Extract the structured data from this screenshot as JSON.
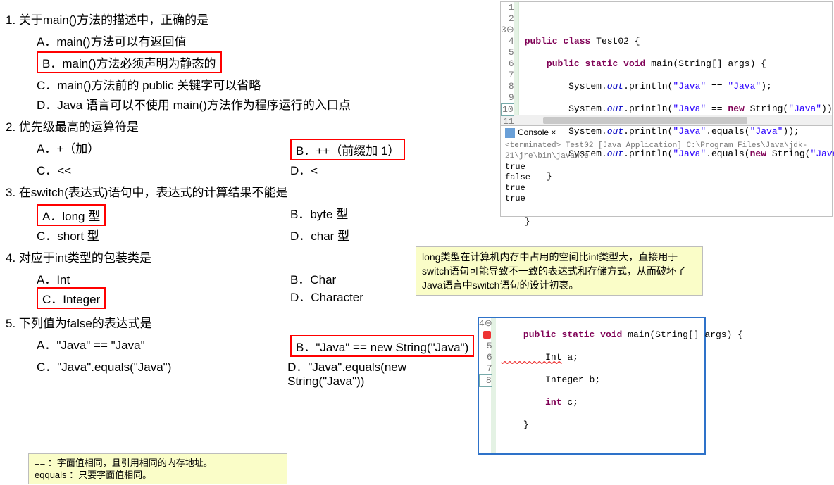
{
  "q1": {
    "title": "1.   关于main()方法的描述中，正确的是",
    "a": "A．main()方法可以有返回值",
    "b": "B．main()方法必须声明为静态的",
    "c": "C．main()方法前的 public 关键字可以省略",
    "d": "D．Java 语言可以不使用 main()方法作为程序运行的入口点"
  },
  "q2": {
    "title": "2.   优先级最高的运算符是",
    "a": "A．+（加）",
    "b": "B．++（前缀加 1）",
    "c": "C．<<",
    "d": "D．<"
  },
  "q3": {
    "title": "3.   在switch(表达式)语句中，表达式的计算结果不能是",
    "a": "A．long 型",
    "b": "B．byte 型",
    "c": "C．short 型",
    "d": "D．char 型"
  },
  "q4": {
    "title": "4.   对应于int类型的包装类是",
    "a": "A．Int",
    "b": "B．Char",
    "c": "C．Integer",
    "d": "D．Character"
  },
  "q5": {
    "title": "5.   下列值为false的表达式是",
    "a": "A．\"Java\" == \"Java\"",
    "b": "B．\"Java\" == new String(\"Java\")",
    "c": "C．\"Java\".equals(\"Java\")",
    "d": "D．\"Java\".equals(new String(\"Java\"))"
  },
  "editor": {
    "lines": [
      "1",
      "2",
      "3",
      "4",
      "5",
      "6",
      "7",
      "8",
      "9",
      "10",
      "11"
    ],
    "c2a": "public class ",
    "c2b": "Test02 {",
    "c3a": "    public static void ",
    "c3b": "main(String[] args) {",
    "c4a": "        System.",
    "c4b": "out",
    "c4c": ".println(",
    "c4d": "\"Java\"",
    "c4e": " == ",
    "c4f": "\"Java\"",
    "c4g": ");",
    "c5d": "\"Java\"",
    "c5e": " == ",
    "c5f": "new ",
    "c5g": "String(",
    "c5h": "\"Java\"",
    "c5i": "));",
    "c6d": "\"Java\"",
    "c6e": ".equals(",
    "c6f": "\"Java\"",
    "c6g": "));",
    "c7d": "\"Java\"",
    "c7e": ".equals(",
    "c7f": "new ",
    "c7g": "String(",
    "c7h": "\"Java\"",
    "c7i": ")));",
    "c8": "    }",
    "c10": "}"
  },
  "console": {
    "tab": "Console ×",
    "info": "<terminated> Test02 [Java Application] C:\\Program Files\\Java\\jdk-21\\jre\\bin\\javaw.e",
    "l1": "true",
    "l2": "false",
    "l3": "true",
    "l4": "true"
  },
  "note3": "long类型在计算机内存中占用的空间比int类型大，直接用于switch语句可能导致不一致的表达式和存储方式，从而破坏了Java语言中switch语句的设计初衷。",
  "note5a": "== ：字面值相同，且引用相同的内存地址。",
  "note5b": "eqquals ：只要字面值相同。",
  "snippet": {
    "lines": [
      "4",
      "5",
      "6",
      "7",
      "8"
    ],
    "l4a": "    public static void ",
    "l4b": "main(String[] args) {",
    "l5a": "        Int",
    "l5b": " a;",
    "l6": "        Integer b;",
    "l7a": "        int ",
    "l7b": "c;",
    "l8": "    }"
  }
}
